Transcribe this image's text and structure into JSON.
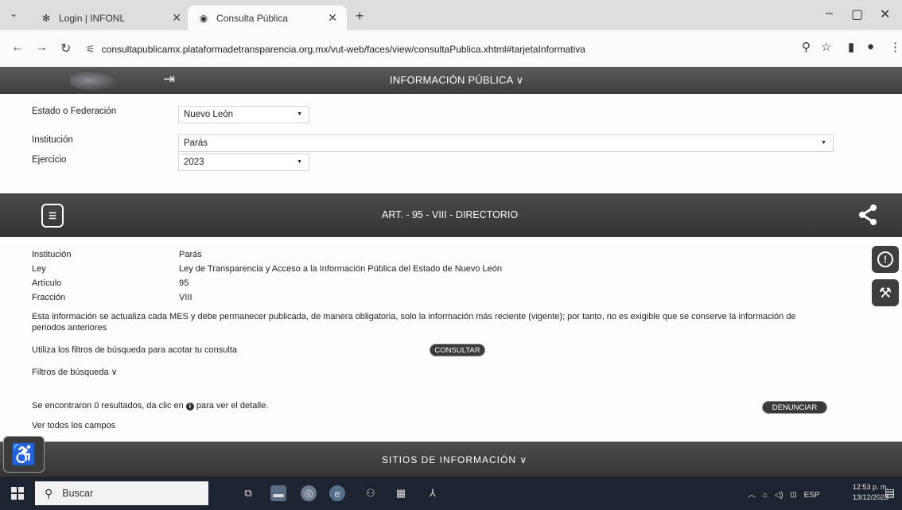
{
  "browser": {
    "tabs": [
      {
        "title": "Login | INFONL"
      },
      {
        "title": "Consulta Pública"
      }
    ],
    "url": "consultapublicamx.plataformadetransparencia.org.mx/vut-web/faces/view/consultaPublica.xhtml#tarjetaInformativa"
  },
  "header": {
    "menu_label": "INFORMACIÓN PÚBLICA ∨"
  },
  "filters": {
    "estado_label": "Estado o Federación",
    "estado_value": "Nuevo León",
    "institucion_label": "Institución",
    "institucion_value": "Parás",
    "ejercicio_label": "Ejercicio",
    "ejercicio_value": "2023"
  },
  "section": {
    "title": "ART. - 95 - VIII - DIRECTORIO"
  },
  "info": {
    "institucion_label": "Institución",
    "institucion_value": "Parás",
    "ley_label": "Ley",
    "ley_value": "Ley de Transparencia y Acceso a la Información Pública del Estado de Nuevo León",
    "articulo_label": "Artículo",
    "articulo_value": "95",
    "fraccion_label": "Fracción",
    "fraccion_value": "VIII",
    "update_note": "Esta información se actualiza cada MES y debe permanecer publicada, de manera obligatoria, solo la información más reciente (vigente); por tanto, no es exigible que se conserve la información de periodos anteriores"
  },
  "search": {
    "hint": "Utiliza los filtros de búsqueda para acotar tu consulta",
    "consultar_label": "CONSULTAR",
    "filtros_label": "Filtros de búsqueda ∨",
    "results_prefix": "Se encontraron 0 resultados, da clic en",
    "results_suffix": "para ver el detalle.",
    "denunciar_label": "DENUNCIAR",
    "ver_todos_label": "Ver todos los campos"
  },
  "footer": {
    "sitios_label": "SITIOS DE INFORMACIÓN ∨"
  },
  "taskbar": {
    "search_placeholder": "Buscar",
    "language": "ESP",
    "time": "12:53 p. m.",
    "date": "13/12/2023"
  }
}
